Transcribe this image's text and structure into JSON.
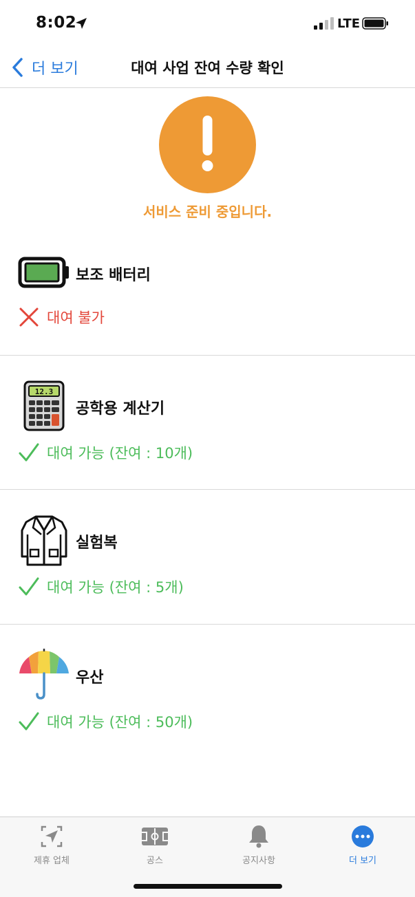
{
  "status_bar": {
    "time": "8:02",
    "network": "LTE",
    "icons": [
      "location-arrow-icon",
      "signal-icon",
      "battery-icon"
    ]
  },
  "nav": {
    "back_label": "더 보기",
    "title": "대여 사업 잔여 수량 확인",
    "back_icon": "chevron-left-icon"
  },
  "notice": {
    "icon": "exclamation-icon",
    "text": "서비스 준비 중입니다."
  },
  "items": [
    {
      "name": "보조 배터리",
      "icon": "battery-pack-icon",
      "status": "대여 불가",
      "available": false
    },
    {
      "name": "공학용 계산기",
      "icon": "calculator-icon",
      "calculator_display": "12.3",
      "status": "대여 가능 (잔여 : 10개)",
      "available": true
    },
    {
      "name": "실험복",
      "icon": "lab-coat-icon",
      "status": "대여 가능 (잔여 : 5개)",
      "available": true
    },
    {
      "name": "우산",
      "icon": "umbrella-icon",
      "status": "대여 가능 (잔여 : 50개)",
      "available": true
    }
  ],
  "tabs": [
    {
      "label": "제휴 업체",
      "icon": "location-scan-icon",
      "active": false
    },
    {
      "label": "공스",
      "icon": "field-icon",
      "active": false
    },
    {
      "label": "공지사항",
      "icon": "bell-icon",
      "active": false
    },
    {
      "label": "더 보기",
      "icon": "more-icon",
      "active": true
    }
  ],
  "colors": {
    "accent": "#2a7bdc",
    "warning": "#ee9a35",
    "unavailable": "#e3463a",
    "available": "#4cbc5a"
  }
}
